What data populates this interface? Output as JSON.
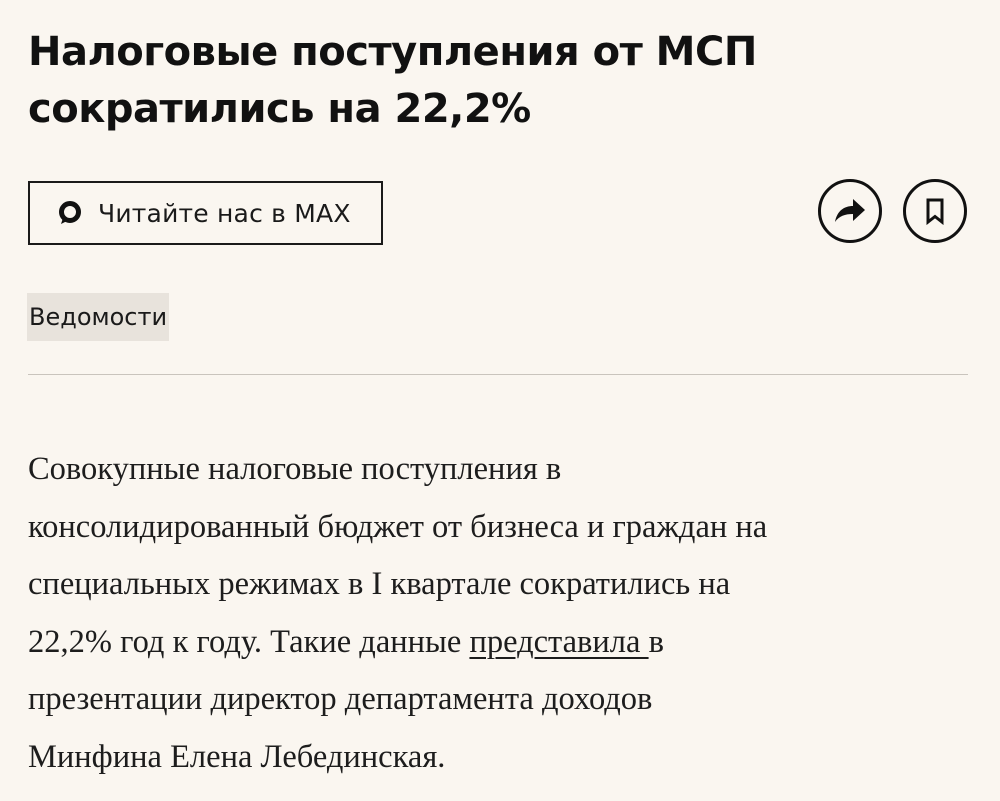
{
  "article": {
    "headline_line1": "Налоговые поступления от МСП",
    "headline_line2": "сократились на 22,2%",
    "read_button_label": "Читайте нас в MAX",
    "read_button_icon": "max-messenger-icon",
    "share_icon": "share-arrow-icon",
    "bookmark_icon": "bookmark-icon",
    "source": "Ведомости",
    "body": {
      "line1": "Совокупные налоговые поступления в",
      "line2": "консолидированный бюджет от бизнеса и граждан на",
      "line3": "специальных режимах в I квартале сократились на",
      "line4_prefix": "22,2% год к году. Такие данные ",
      "link": "представила ",
      "line4_suffix": "в",
      "line5": "презентации директор департамента доходов",
      "line6": "Минфина Елена Лебединская."
    }
  },
  "colors": {
    "background": "#faf6f0",
    "text": "#111111",
    "tag_background": "#e8e3dc",
    "divider": "#c9c4bd"
  }
}
